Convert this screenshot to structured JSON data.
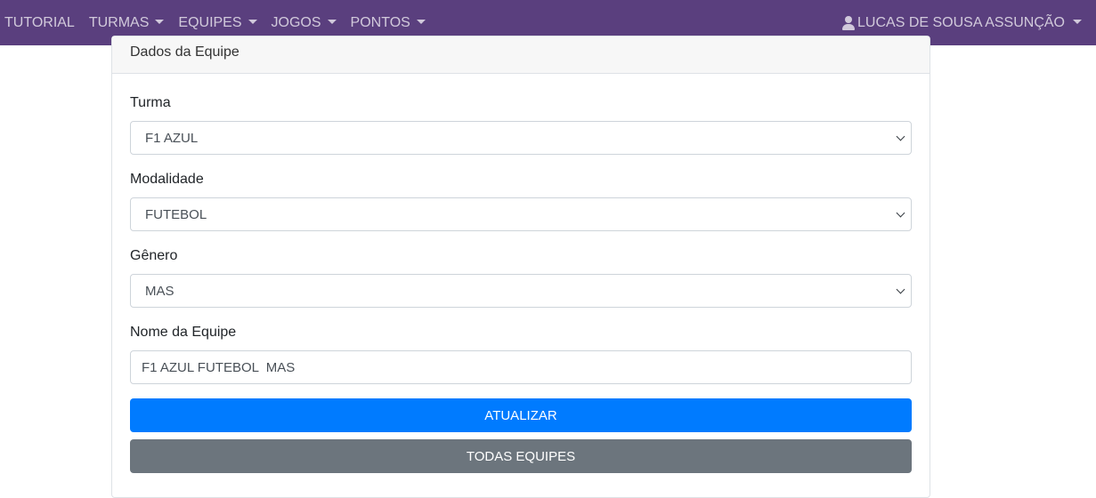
{
  "navbar": {
    "items": [
      {
        "label": "TUTORIAL",
        "dropdown": false
      },
      {
        "label": "TURMAS",
        "dropdown": true
      },
      {
        "label": "EQUIPES",
        "dropdown": true
      },
      {
        "label": "JOGOS",
        "dropdown": true
      },
      {
        "label": "PONTOS",
        "dropdown": true
      }
    ],
    "user_label": "LUCAS DE SOUSA ASSUNÇÃO",
    "background_color": "#5a3f7e"
  },
  "card": {
    "header": "Dados da Equipe"
  },
  "form": {
    "turma": {
      "label": "Turma",
      "value": "F1 AZUL"
    },
    "modalidade": {
      "label": "Modalidade",
      "value": "FUTEBOL"
    },
    "genero": {
      "label": "Gênero",
      "value": "MAS"
    },
    "nome": {
      "label": "Nome da Equipe",
      "value": "F1 AZUL FUTEBOL  MAS"
    }
  },
  "buttons": {
    "update_label": "ATUALIZAR",
    "all_teams_label": "TODAS EQUIPES",
    "primary_color": "#007bff",
    "secondary_color": "#6c757d"
  }
}
